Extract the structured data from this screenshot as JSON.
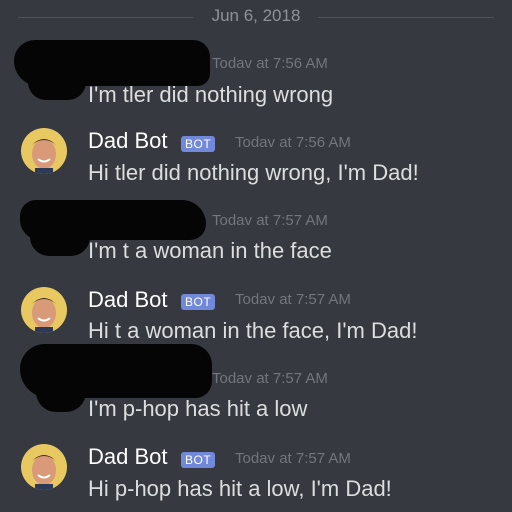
{
  "date_divider": "Jun 6, 2018",
  "messages": [
    {
      "author": "",
      "timestamp": "Todav at 7:56 AM",
      "text": "I'm tler did nothing wrong",
      "redacted": true
    },
    {
      "author": "Dad Bot",
      "badge": "BOT",
      "timestamp": "Todav at 7:56 AM",
      "text": "Hi tler did nothing wrong, I'm Dad!",
      "avatar": "dad-bot-avatar-icon"
    },
    {
      "author": "",
      "timestamp": "Todav at 7:57 AM",
      "text": "I'm t a woman in the face",
      "redacted": true
    },
    {
      "author": "Dad Bot",
      "badge": "BOT",
      "timestamp": "Todav at 7:57 AM",
      "text": "Hi t a woman in the face, I'm Dad!",
      "avatar": "dad-bot-avatar-icon"
    },
    {
      "author": "",
      "timestamp": "Todav at 7:57 AM",
      "text": "I'm p-hop has hit a low",
      "redacted": true
    },
    {
      "author": "Dad Bot",
      "badge": "BOT",
      "timestamp": "Todav at 7:57 AM",
      "text": "Hi p-hop has hit a low, I'm Dad!",
      "avatar": "dad-bot-avatar-icon"
    }
  ],
  "colors": {
    "background": "#36393f",
    "bot_badge": "#7289da",
    "timestamp": "#72767d",
    "text": "#dcddde",
    "author": "#ffffff"
  }
}
